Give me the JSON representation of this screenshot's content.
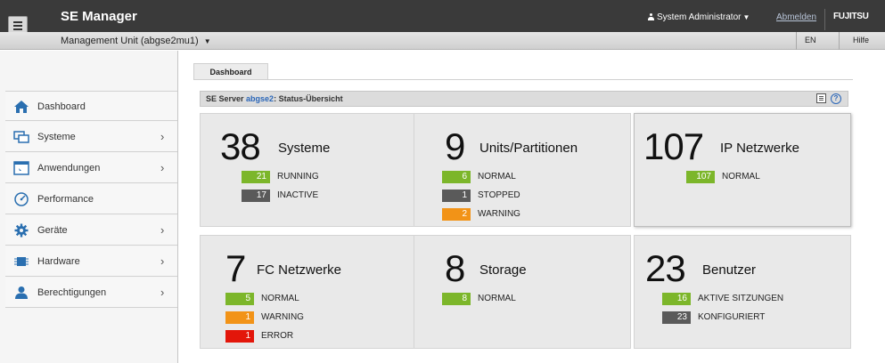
{
  "header": {
    "app_title": "SE Manager",
    "user_label": "System Administrator",
    "logout_label": "Abmelden",
    "brand": "FUJITSU"
  },
  "unitbar": {
    "unit_label": "Management Unit (abgse2mu1)",
    "language": "EN",
    "help": "Hilfe"
  },
  "sidebar": {
    "items": [
      {
        "label": "Dashboard",
        "icon": "home-icon"
      },
      {
        "label": "Systeme",
        "icon": "monitor-icon"
      },
      {
        "label": "Anwendungen",
        "icon": "application-window-icon"
      },
      {
        "label": "Performance",
        "icon": "gauge-icon"
      },
      {
        "label": "Geräte",
        "icon": "gear-icon"
      },
      {
        "label": "Hardware",
        "icon": "chip-icon"
      },
      {
        "label": "Berechtigungen",
        "icon": "user-icon"
      }
    ]
  },
  "main": {
    "tab": "Dashboard",
    "panel": {
      "title_prefix": "SE Server",
      "server_name": "abgse2",
      "title_suffix": ": Status-Übersicht"
    },
    "cards": [
      {
        "count": "38",
        "title": "Systeme",
        "rows": [
          {
            "value": "21",
            "label": "RUNNING",
            "color": "#7cb62a"
          },
          {
            "value": "17",
            "label": "INACTIVE",
            "color": "#5a5a5a"
          }
        ]
      },
      {
        "count": "9",
        "title": "Units/Partitionen",
        "rows": [
          {
            "value": "6",
            "label": "NORMAL",
            "color": "#7cb62a"
          },
          {
            "value": "1",
            "label": "STOPPED",
            "color": "#5a5a5a"
          },
          {
            "value": "2",
            "label": "WARNING",
            "color": "#f29317"
          }
        ]
      },
      {
        "count": "107",
        "title": "IP Netzwerke",
        "rows": [
          {
            "value": "107",
            "label": "NORMAL",
            "color": "#7cb62a"
          }
        ]
      },
      {
        "count": "7",
        "title": "FC Netzwerke",
        "rows": [
          {
            "value": "5",
            "label": "NORMAL",
            "color": "#7cb62a"
          },
          {
            "value": "1",
            "label": "WARNING",
            "color": "#f29317"
          },
          {
            "value": "1",
            "label": "ERROR",
            "color": "#e3160a"
          }
        ]
      },
      {
        "count": "8",
        "title": "Storage",
        "rows": [
          {
            "value": "8",
            "label": "NORMAL",
            "color": "#7cb62a"
          }
        ]
      },
      {
        "count": "23",
        "title": "Benutzer",
        "rows": [
          {
            "value": "16",
            "label": "AKTIVE SITZUNGEN",
            "color": "#7cb62a"
          },
          {
            "value": "23",
            "label": "KONFIGURIERT",
            "color": "#5a5a5a"
          }
        ]
      }
    ]
  }
}
